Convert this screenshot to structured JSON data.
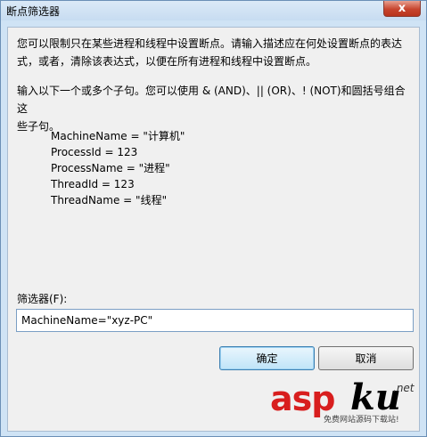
{
  "window": {
    "title": "断点筛选器",
    "close_glyph": "x"
  },
  "description": {
    "line1": "您可以限制只在某些进程和线程中设置断点。请输入描述应在何处设置断点的表达",
    "line2": "式，或者，清除该表达式，以便在所有进程和线程中设置断点。",
    "line3": "输入以下一个或多个子句。您可以使用 & (AND)、|| (OR)、! (NOT)和圆括号组合这",
    "line4": "些子句。"
  },
  "examples": [
    "MachineName = \"计算机\"",
    "ProcessId = 123",
    "ProcessName = \"进程\"",
    "ThreadId = 123",
    "ThreadName = \"线程\""
  ],
  "filter": {
    "label": "筛选器(F):",
    "value": "MachineName=\"xyz-PC\""
  },
  "buttons": {
    "ok": "确定",
    "cancel": "取消"
  },
  "watermark": {
    "asp": "asp",
    "ku": "ku",
    "net": ".net",
    "sub": "免费网站源码下载站!"
  }
}
